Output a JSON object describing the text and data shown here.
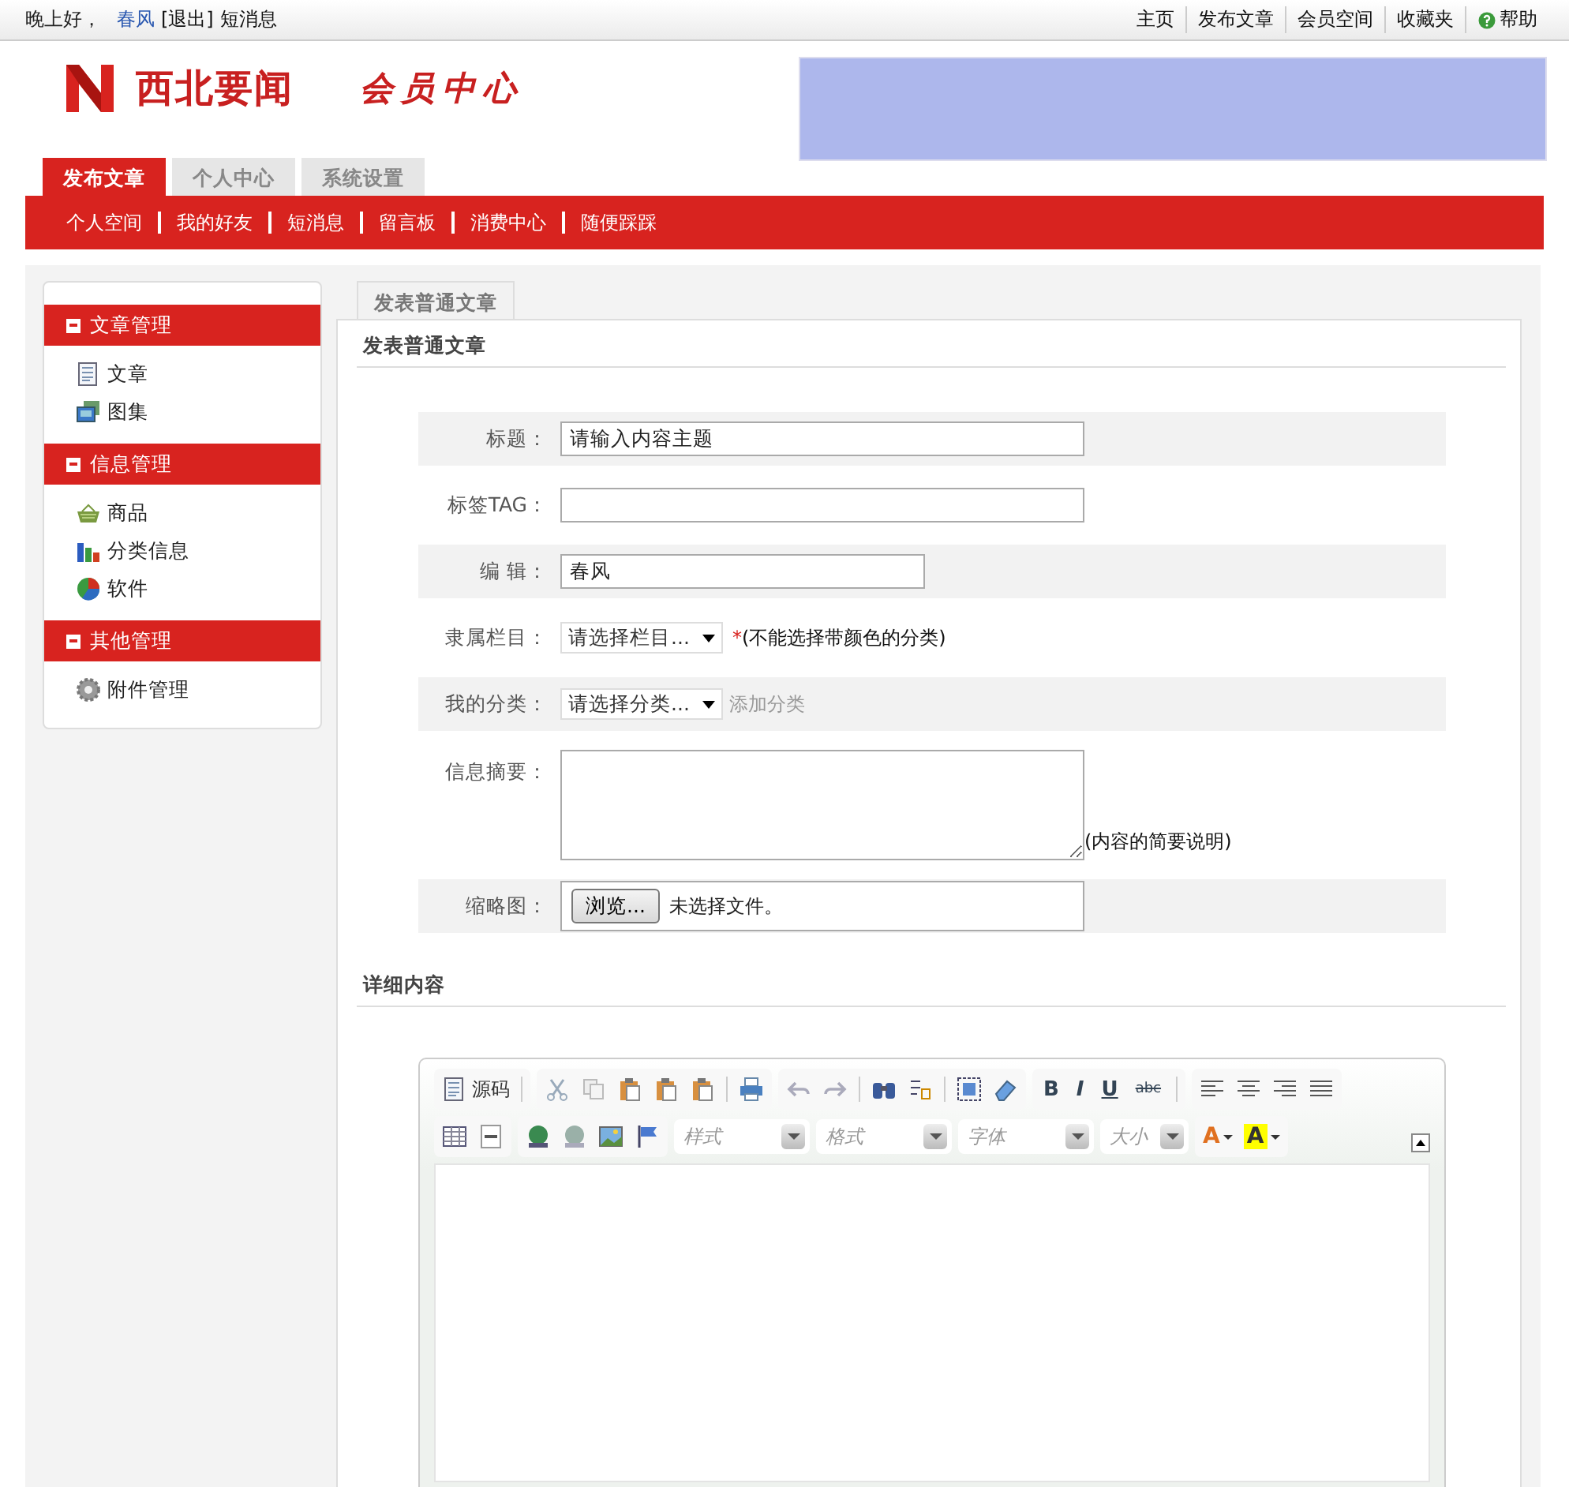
{
  "top_bar": {
    "greeting": "晚上好，",
    "user": "春风",
    "logout": "[退出]",
    "messages": "短消息",
    "links": [
      "主页",
      "发布文章",
      "会员空间",
      "收藏夹"
    ],
    "help": "帮助"
  },
  "header": {
    "site_name": "西北要闻",
    "subtitle": "会员中心",
    "tabs": [
      {
        "label": "发布文章",
        "selected": true
      },
      {
        "label": "个人中心",
        "selected": false
      },
      {
        "label": "系统设置",
        "selected": false
      }
    ],
    "subnav": [
      "个人空间",
      "我的好友",
      "短消息",
      "留言板",
      "消费中心",
      "随便踩踩"
    ]
  },
  "sidebar": {
    "groups": [
      {
        "title": "文章管理",
        "expanded": true,
        "items": [
          "文章",
          "图集"
        ]
      },
      {
        "title": "信息管理",
        "expanded": true,
        "items": [
          "商品",
          "分类信息",
          "软件"
        ]
      },
      {
        "title": "其他管理",
        "expanded": true,
        "items": [
          "附件管理"
        ]
      }
    ]
  },
  "main": {
    "tab": "发表普通文章",
    "section_title": "发表普通文章",
    "form": [
      {
        "label": "标题：",
        "kind": "text",
        "value": "请输入内容主题"
      },
      {
        "label": "标签TAG：",
        "kind": "text"
      },
      {
        "label": "编 辑：",
        "kind": "shorttext",
        "value": "春风"
      },
      {
        "label": "隶属栏目：",
        "kind": "select",
        "value": "请选择栏目...",
        "required_mark": "*",
        "note": "(不能选择带颜色的分类)"
      },
      {
        "label": "我的分类：",
        "kind": "select",
        "value": "请选择分类...",
        "link": "添加分类"
      },
      {
        "label": "信息摘要：",
        "kind": "textarea",
        "note": "(内容的简要说明)"
      },
      {
        "label": "缩略图：",
        "kind": "file",
        "button": "浏览...",
        "value": "未选择文件。"
      }
    ],
    "detail_title": "详细内容",
    "editor": {
      "source_label": "源码",
      "format_buttons": [
        "B",
        "I",
        "U",
        "abc"
      ],
      "dropdowns": [
        "样式",
        "格式",
        "字体",
        "大小"
      ],
      "color_buttons": [
        "A",
        "A"
      ]
    }
  }
}
